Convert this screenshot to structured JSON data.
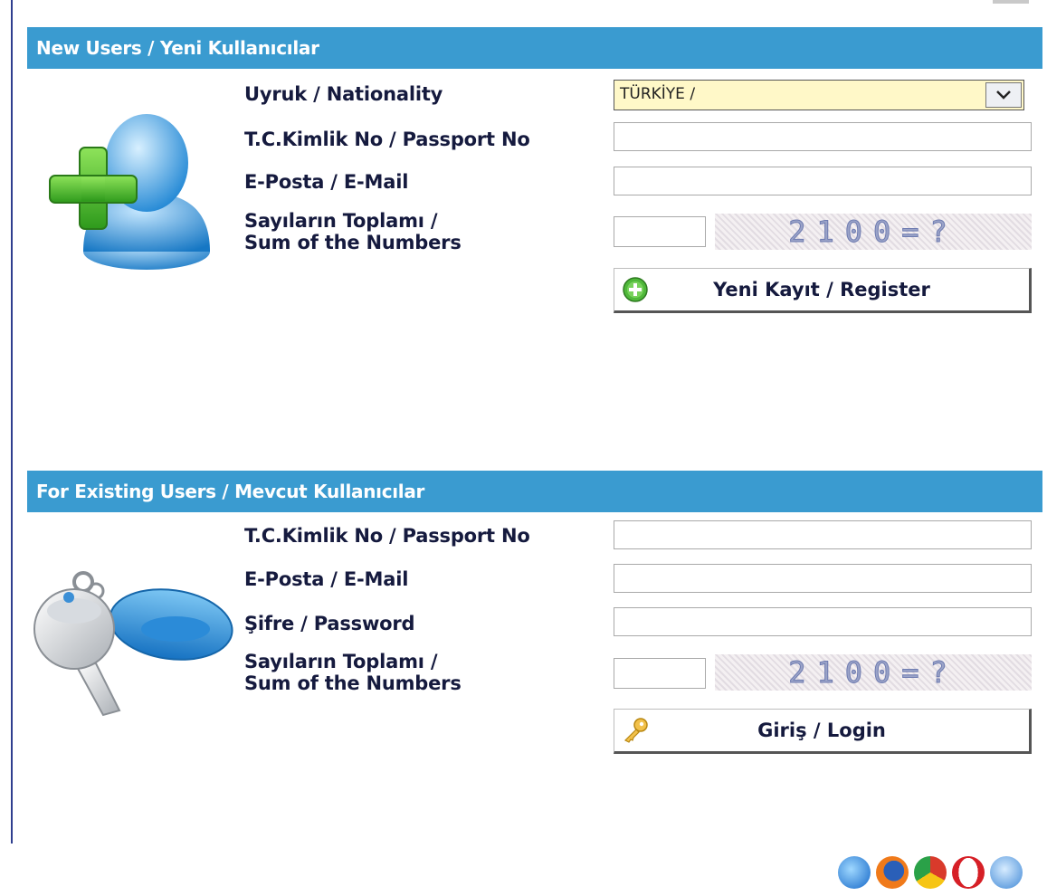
{
  "new_users": {
    "header": "New Users / Yeni Kullanıcılar",
    "nationality_label": "Uyruk / Nationality",
    "nationality_value": "TÜRKİYE /",
    "id_label": "T.C.Kimlik No / Passport No",
    "email_label": "E-Posta / E-Mail",
    "sum_label_line1": "Sayıların Toplamı /",
    "sum_label_line2": "Sum of the Numbers",
    "captcha_text": "2100=?",
    "register_button": "Yeni Kayıt / Register"
  },
  "existing_users": {
    "header": "For Existing Users / Mevcut Kullanıcılar",
    "id_label": "T.C.Kimlik No / Passport No",
    "email_label": "E-Posta / E-Mail",
    "password_label": "Şifre / Password",
    "sum_label_line1": "Sayıların Toplamı /",
    "sum_label_line2": "Sum of the Numbers",
    "captcha_text": "2100=?",
    "login_button": "Giriş / Login"
  },
  "icons": {
    "new_user": "add-user-icon",
    "existing_user": "key-icon",
    "register": "plus-circle-icon",
    "login": "key-icon",
    "browsers": [
      "internet-explorer-icon",
      "firefox-icon",
      "chrome-icon",
      "opera-icon",
      "safari-icon"
    ]
  },
  "colors": {
    "header_bg": "#3a9bd0",
    "header_text": "#ffffff",
    "label_text": "#151a3e",
    "select_bg": "#fff8c8"
  }
}
